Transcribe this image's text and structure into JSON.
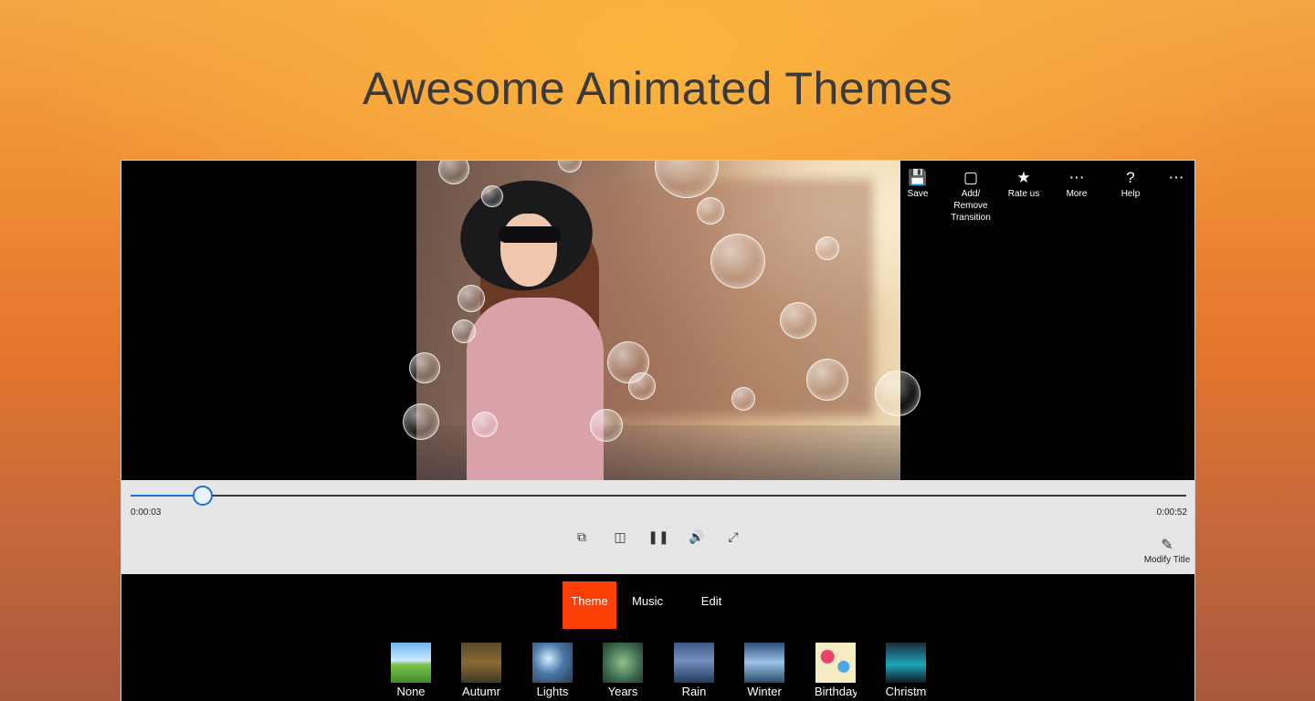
{
  "headline": "Awesome Animated Themes",
  "toolbar": {
    "items": [
      {
        "icon": "save-icon",
        "label": "Save"
      },
      {
        "icon": "square-icon",
        "label": "Add/\nRemove\nTransition"
      },
      {
        "icon": "star-icon",
        "label": "Rate us"
      },
      {
        "icon": "ellipsis-icon",
        "label": "More"
      },
      {
        "icon": "help-icon",
        "label": "Help"
      },
      {
        "icon": "overflow-icon",
        "label": ""
      }
    ]
  },
  "player": {
    "current_time": "0:00:03",
    "total_time": "0:00:52",
    "progress": 0.068,
    "controls": [
      "cast-icon",
      "trim-icon",
      "pause-icon",
      "volume-icon",
      "fullscreen-icon"
    ],
    "modify_title": "Modify Title"
  },
  "tabs": [
    {
      "label": "Theme",
      "active": true
    },
    {
      "label": "Music",
      "active": false
    },
    {
      "label": "Edit",
      "active": false
    }
  ],
  "themes": [
    {
      "label": "None"
    },
    {
      "label": "Autumr"
    },
    {
      "label": "Lights"
    },
    {
      "label": "Years"
    },
    {
      "label": "Rain"
    },
    {
      "label": "Winter"
    },
    {
      "label": "Birthday"
    },
    {
      "label": "Christm"
    }
  ],
  "colors": {
    "accent": "#fb3f06",
    "slider": "#1e6fd6"
  }
}
